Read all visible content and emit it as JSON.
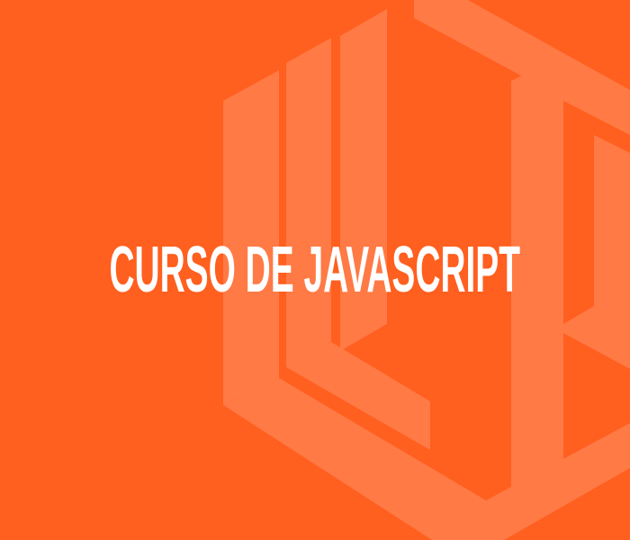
{
  "banner": {
    "title": "CURSO DE JAVASCRIPT",
    "background_color": "#ff5f1f",
    "watermark_color": "#ff7a45",
    "watermark_icon": "wp-hexagon-logo-icon"
  }
}
